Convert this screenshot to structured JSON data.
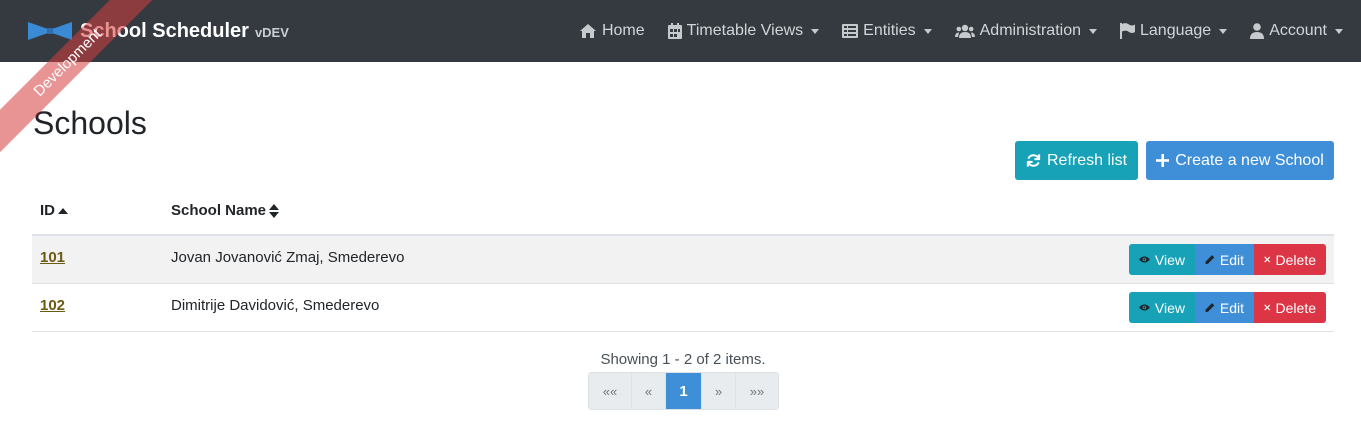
{
  "app": {
    "title": "School Scheduler",
    "version": "vDEV",
    "ribbon": "Development"
  },
  "nav": {
    "items": [
      {
        "label": "Home",
        "icon": "home-icon",
        "dropdown": false
      },
      {
        "label": "Timetable Views",
        "icon": "calendar-icon",
        "dropdown": true
      },
      {
        "label": "Entities",
        "icon": "list-icon",
        "dropdown": true
      },
      {
        "label": "Administration",
        "icon": "users-icon",
        "dropdown": true
      },
      {
        "label": "Language",
        "icon": "flag-icon",
        "dropdown": true
      },
      {
        "label": "Account",
        "icon": "user-icon",
        "dropdown": true
      }
    ]
  },
  "page": {
    "title": "Schools",
    "refresh_label": "Refresh list",
    "create_label": "Create a new School"
  },
  "table": {
    "columns": [
      "ID",
      "School Name"
    ],
    "rows": [
      {
        "id": "101",
        "name": "Jovan Jovanović Zmaj, Smederevo"
      },
      {
        "id": "102",
        "name": "Dimitrije Davidović, Smederevo"
      }
    ],
    "actions": {
      "view": "View",
      "edit": "Edit",
      "delete": "Delete"
    }
  },
  "pagination": {
    "summary": "Showing 1 - 2 of 2 items.",
    "first": "««",
    "prev": "«",
    "current": "1",
    "next": "»",
    "last": "»»"
  },
  "colors": {
    "navbar": "#343a40",
    "info": "#17a2b8",
    "primary": "#3e8fd8",
    "danger": "#dc3545",
    "link": "#6b5a13"
  }
}
